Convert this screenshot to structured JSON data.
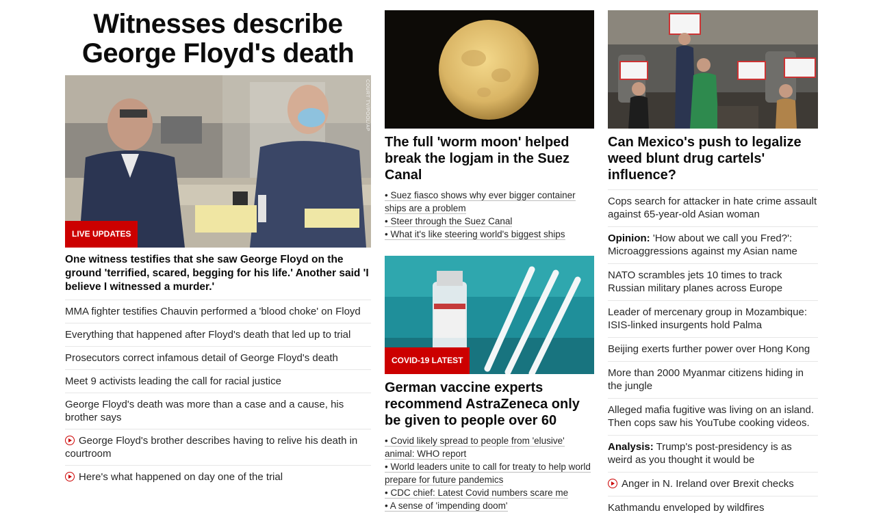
{
  "lead": {
    "headline": "Witnesses describe George Floyd's death",
    "image_alt": "Courtroom with Derek Chauvin and attorney",
    "photo_credit": "COURT TV/POOL/AP",
    "badge": "LIVE UPDATES",
    "summary": "One witness testifies that she saw George Floyd on the ground 'terrified, scared, begging for his life.' Another said 'I believe I witnessed a murder.'",
    "links": [
      {
        "text": "MMA fighter testifies Chauvin performed a 'blood choke' on Floyd",
        "video": false
      },
      {
        "text": "Everything that happened after Floyd's death that led up to trial",
        "video": false
      },
      {
        "text": "Prosecutors correct infamous detail of George Floyd's death",
        "video": false
      },
      {
        "text": "Meet 9 activists leading the call for racial justice",
        "video": false
      },
      {
        "text": "George Floyd's death was more than a case and a cause, his brother says",
        "video": false
      },
      {
        "text": "George Floyd's brother describes having to relive his death in courtroom",
        "video": true
      },
      {
        "text": "Here's what happened on day one of the trial",
        "video": true
      }
    ]
  },
  "moon": {
    "title": "The full 'worm moon' helped break the logjam in the Suez Canal",
    "bullets": [
      "• Suez fiasco shows why ever bigger container ships are a problem",
      "• Steer through the Suez Canal",
      "• What it's like steering world's biggest ships"
    ]
  },
  "vaccine": {
    "badge": "COVID-19 LATEST",
    "title": "German vaccine experts recommend AstraZeneca only be given to people over 60",
    "bullets": [
      "• Covid likely spread to people from 'elusive' animal: WHO report",
      "• World leaders unite to call for treaty to help world prepare for future pandemics",
      "• CDC chief: Latest Covid numbers scare me",
      "• A sense of 'impending doom'"
    ]
  },
  "mexico": {
    "title": "Can Mexico's push to legalize weed blunt drug cartels' influence?",
    "links": [
      {
        "kicker": "",
        "text": "Cops search for attacker in hate crime assault against 65-year-old Asian woman",
        "video": false
      },
      {
        "kicker": "Opinion:",
        "text": " 'How about we call you Fred?': Microaggressions against my Asian name",
        "video": false
      },
      {
        "kicker": "",
        "text": "NATO scrambles jets 10 times to track Russian military planes across Europe",
        "video": false
      },
      {
        "kicker": "",
        "text": "Leader of mercenary group in Mozambique: ISIS-linked insurgents hold Palma",
        "video": false
      },
      {
        "kicker": "",
        "text": "Beijing exerts further power over Hong Kong",
        "video": false
      },
      {
        "kicker": "",
        "text": "More than 2000 Myanmar citizens hiding in the jungle",
        "video": false
      },
      {
        "kicker": "",
        "text": "Alleged mafia fugitive was living on an island. Then cops saw his YouTube cooking videos.",
        "video": false
      },
      {
        "kicker": "Analysis:",
        "text": " Trump's post-presidency is as weird as you thought it would be",
        "video": false
      },
      {
        "kicker": "",
        "text": "Anger in N. Ireland over Brexit checks",
        "video": true
      },
      {
        "kicker": "",
        "text": "Kathmandu enveloped by wildfires",
        "video": false
      }
    ]
  },
  "colors": {
    "accent": "#cc0000",
    "divider": "#e6e6e6"
  }
}
